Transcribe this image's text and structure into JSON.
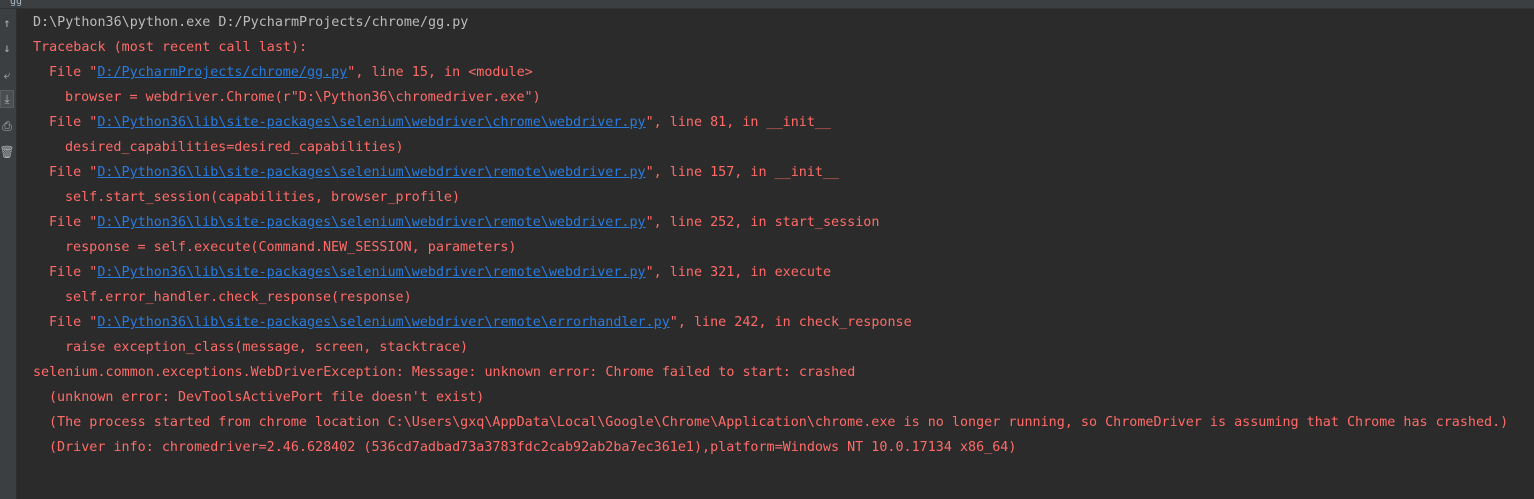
{
  "window": {
    "tab_label": "gg"
  },
  "toolbar": {
    "buttons": [
      {
        "name": "up-arrow-icon",
        "glyph": "↑"
      },
      {
        "name": "down-arrow-icon",
        "glyph": "↓"
      },
      {
        "name": "soft-wrap-icon",
        "glyph": "⤶"
      },
      {
        "name": "scroll-to-end-icon",
        "glyph": "⤓"
      },
      {
        "name": "print-icon",
        "glyph": "⎙"
      },
      {
        "name": "trash-icon",
        "glyph": "🗑"
      }
    ]
  },
  "console": {
    "colors": {
      "error": "#ff6b68",
      "command": "#bbbbbb",
      "link": "#287bde",
      "background": "#2b2b2b"
    },
    "lines": [
      {
        "type": "command",
        "indent": 0,
        "text": "D:\\Python36\\python.exe D:/PycharmProjects/chrome/gg.py"
      },
      {
        "type": "error",
        "indent": 0,
        "text": "Traceback (most recent call last):"
      },
      {
        "type": "frame",
        "indent": 2,
        "pre": "File \"",
        "link": "D:/PycharmProjects/chrome/gg.py",
        "post": "\", line 15, in <module>"
      },
      {
        "type": "error",
        "indent": 4,
        "text": "browser = webdriver.Chrome(r\"D:\\Python36\\chromedriver.exe\")"
      },
      {
        "type": "frame",
        "indent": 2,
        "pre": "File \"",
        "link": "D:\\Python36\\lib\\site-packages\\selenium\\webdriver\\chrome\\webdriver.py",
        "post": "\", line 81, in __init__"
      },
      {
        "type": "error",
        "indent": 4,
        "text": "desired_capabilities=desired_capabilities)"
      },
      {
        "type": "frame",
        "indent": 2,
        "pre": "File \"",
        "link": "D:\\Python36\\lib\\site-packages\\selenium\\webdriver\\remote\\webdriver.py",
        "post": "\", line 157, in __init__"
      },
      {
        "type": "error",
        "indent": 4,
        "text": "self.start_session(capabilities, browser_profile)"
      },
      {
        "type": "frame",
        "indent": 2,
        "pre": "File \"",
        "link": "D:\\Python36\\lib\\site-packages\\selenium\\webdriver\\remote\\webdriver.py",
        "post": "\", line 252, in start_session"
      },
      {
        "type": "error",
        "indent": 4,
        "text": "response = self.execute(Command.NEW_SESSION, parameters)"
      },
      {
        "type": "frame",
        "indent": 2,
        "pre": "File \"",
        "link": "D:\\Python36\\lib\\site-packages\\selenium\\webdriver\\remote\\webdriver.py",
        "post": "\", line 321, in execute"
      },
      {
        "type": "error",
        "indent": 4,
        "text": "self.error_handler.check_response(response)"
      },
      {
        "type": "frame",
        "indent": 2,
        "pre": "File \"",
        "link": "D:\\Python36\\lib\\site-packages\\selenium\\webdriver\\remote\\errorhandler.py",
        "post": "\", line 242, in check_response"
      },
      {
        "type": "error",
        "indent": 4,
        "text": "raise exception_class(message, screen, stacktrace)"
      },
      {
        "type": "error",
        "indent": 0,
        "text": "selenium.common.exceptions.WebDriverException: Message: unknown error: Chrome failed to start: crashed"
      },
      {
        "type": "error",
        "indent": 2,
        "text": "(unknown error: DevToolsActivePort file doesn't exist)"
      },
      {
        "type": "error",
        "indent": 2,
        "text": "(The process started from chrome location C:\\Users\\gxq\\AppData\\Local\\Google\\Chrome\\Application\\chrome.exe is no longer running, so ChromeDriver is assuming that Chrome has crashed.)"
      },
      {
        "type": "error",
        "indent": 2,
        "text": "(Driver info: chromedriver=2.46.628402 (536cd7adbad73a3783fdc2cab92ab2ba7ec361e1),platform=Windows NT 10.0.17134 x86_64)"
      }
    ]
  }
}
